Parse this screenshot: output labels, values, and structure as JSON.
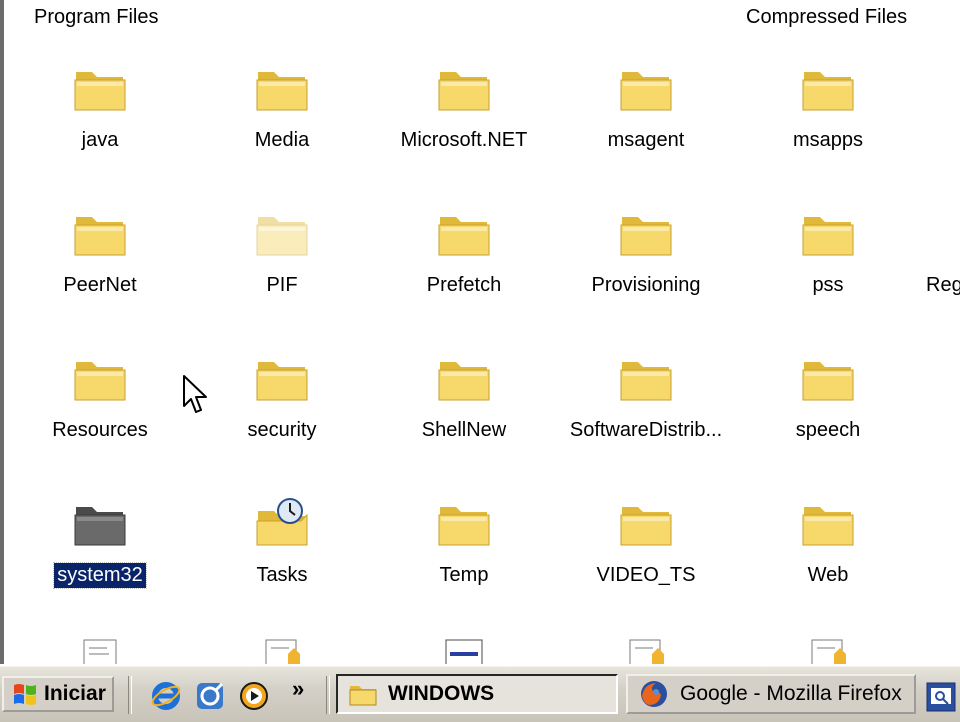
{
  "explorer": {
    "top_labels": [
      "Program Files",
      "Compressed Files"
    ],
    "rows": [
      [
        {
          "label": "java"
        },
        {
          "label": "Media"
        },
        {
          "label": "Microsoft.NET"
        },
        {
          "label": "msagent"
        },
        {
          "label": "msapps"
        }
      ],
      [
        {
          "label": "PeerNet"
        },
        {
          "label": "PIF"
        },
        {
          "label": "Prefetch"
        },
        {
          "label": "Provisioning"
        },
        {
          "label": "pss"
        },
        {
          "label": "Reg"
        }
      ],
      [
        {
          "label": "Resources"
        },
        {
          "label": "security"
        },
        {
          "label": "ShellNew"
        },
        {
          "label": "SoftwareDistrib..."
        },
        {
          "label": "speech"
        }
      ],
      [
        {
          "label": "system32"
        },
        {
          "label": "Tasks"
        },
        {
          "label": "Temp"
        },
        {
          "label": "VIDEO_TS"
        },
        {
          "label": "Web"
        }
      ]
    ],
    "selected_item": "system32"
  },
  "taskbar": {
    "start_label": "Iniciar",
    "quick_launch": [
      "ie-icon",
      "outlook-icon",
      "media-player-icon"
    ],
    "more_label": "»",
    "tasks": [
      {
        "label": "WINDOWS",
        "icon": "folder-icon",
        "active": true
      },
      {
        "label": "Google - Mozilla Firefox",
        "icon": "firefox-icon",
        "active": false
      }
    ]
  },
  "colors": {
    "folder_yellow": "#f7d86a",
    "folder_shade": "#e0b93a",
    "selection_blue": "#0a246a",
    "taskbar": "#d4d0c8"
  }
}
